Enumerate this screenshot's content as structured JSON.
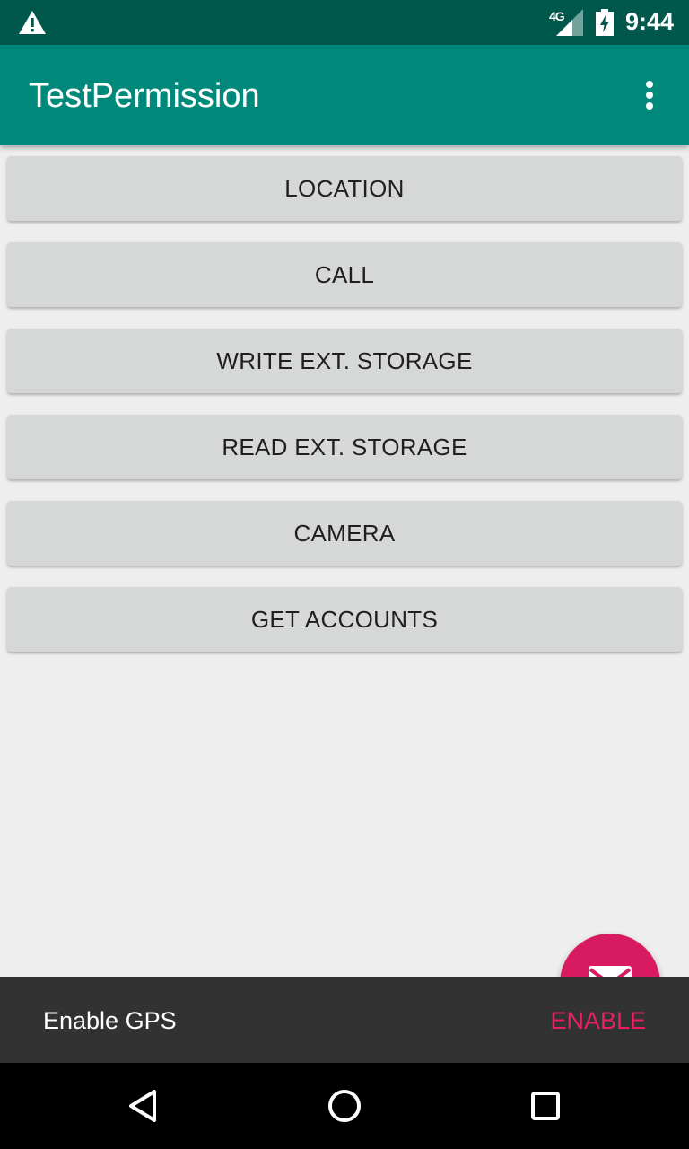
{
  "status_bar": {
    "network": "4G",
    "time": "9:44",
    "icons": [
      "warning-icon",
      "signal-icon",
      "battery-charging-icon"
    ]
  },
  "app_bar": {
    "title": "TestPermission",
    "overflow_icon": "more-vert-icon"
  },
  "buttons": [
    {
      "label": "LOCATION"
    },
    {
      "label": "CALL"
    },
    {
      "label": "WRITE EXT. STORAGE"
    },
    {
      "label": "READ EXT. STORAGE"
    },
    {
      "label": "CAMERA"
    },
    {
      "label": "GET ACCOUNTS"
    }
  ],
  "fab": {
    "icon": "email-icon",
    "color": "#d81b60"
  },
  "snackbar": {
    "message": "Enable GPS",
    "action": "ENABLE",
    "action_color": "#e91e63"
  },
  "nav_bar": {
    "icons": [
      "back-icon",
      "home-icon",
      "recents-icon"
    ]
  },
  "colors": {
    "primary": "#00897b",
    "primary_dark": "#00574b",
    "accent": "#d81b60"
  }
}
